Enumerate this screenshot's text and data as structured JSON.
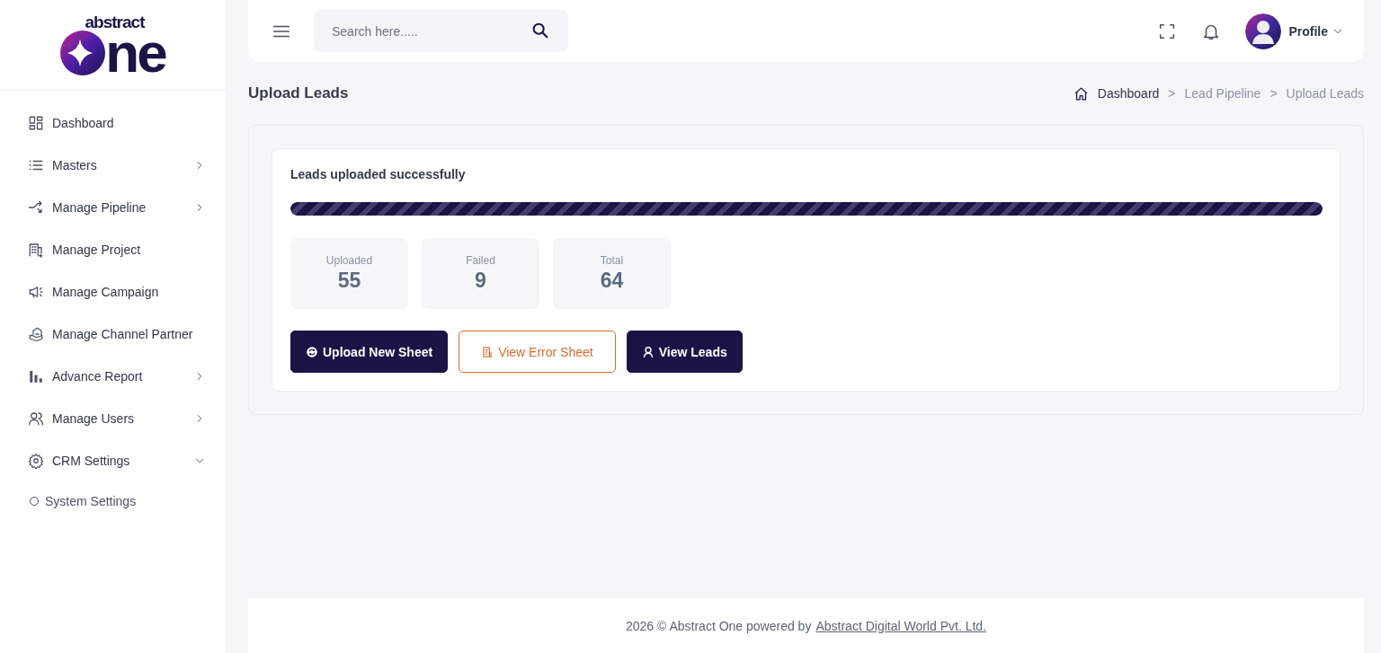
{
  "logo": {
    "top": "abstract",
    "bottom": "ne"
  },
  "sidebar": {
    "items": [
      {
        "label": "Dashboard"
      },
      {
        "label": "Masters",
        "expanded": false
      },
      {
        "label": "Manage Pipeline",
        "expanded": false
      },
      {
        "label": "Manage Project"
      },
      {
        "label": "Manage Campaign"
      },
      {
        "label": "Manage Channel Partner"
      },
      {
        "label": "Advance Report",
        "expanded": false
      },
      {
        "label": "Manage Users",
        "expanded": false
      },
      {
        "label": "CRM Settings",
        "expanded": true,
        "children": [
          {
            "label": "System Settings"
          }
        ]
      }
    ]
  },
  "header": {
    "search": {
      "placeholder": "Search here....."
    },
    "profile": "Profile"
  },
  "page_title": "Upload Leads",
  "breadcrumb": [
    {
      "label": "Dashboard"
    },
    {
      "label": "Lead Pipeline"
    },
    {
      "label": "Upload Leads"
    }
  ],
  "breadcrumb_separator": ">",
  "upload": {
    "message": "Leads uploaded successfully",
    "level": 1,
    "stats": [
      {
        "label": "Uploaded",
        "value": "55"
      },
      {
        "label": "Failed",
        "value": "9"
      },
      {
        "label": "Total",
        "value": "64"
      }
    ],
    "buttons": [
      {
        "label": "Upload New Sheet",
        "kind": "primary"
      },
      {
        "label": "View Error Sheet",
        "kind": "outline"
      },
      {
        "label": "View Leads",
        "kind": "primary"
      }
    ]
  },
  "footer": {
    "text": "2026 © Abstract One powered by",
    "link": "Abstract Digital World Pvt. Ltd."
  }
}
